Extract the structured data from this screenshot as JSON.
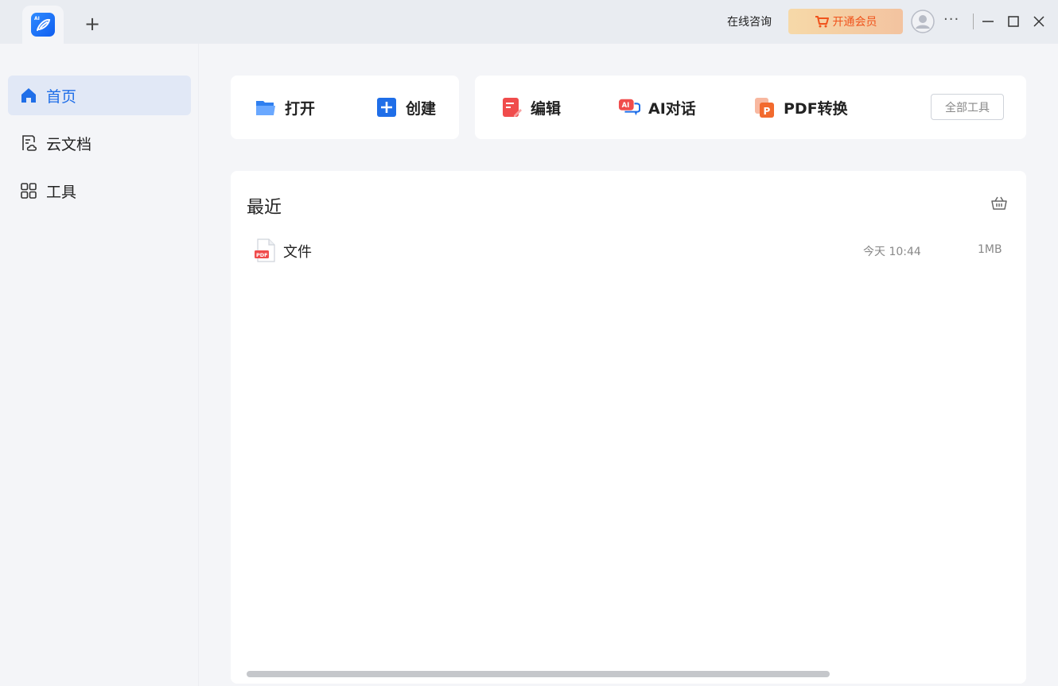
{
  "titlebar": {
    "new_tab": "+",
    "consult": "在线咨询",
    "vip": "开通会员",
    "more": "···"
  },
  "sidebar": {
    "items": [
      {
        "label": "首页",
        "icon": "home-icon",
        "active": true
      },
      {
        "label": "云文档",
        "icon": "cloud-doc-icon",
        "active": false
      },
      {
        "label": "工具",
        "icon": "grid-icon",
        "active": false
      }
    ]
  },
  "tools": {
    "open": "打开",
    "create": "创建",
    "edit": "编辑",
    "ai_chat": "AI对话",
    "pdf_convert": "PDF转换",
    "all_tools": "全部工具"
  },
  "recent": {
    "title": "最近",
    "files": [
      {
        "name": "文件",
        "time": "今天 10:44",
        "size": "1MB",
        "type_badge": "PDF"
      }
    ]
  },
  "colors": {
    "accent": "#1f6ee8",
    "vip_text": "#f0531c",
    "pdf_red": "#f04c4c"
  }
}
